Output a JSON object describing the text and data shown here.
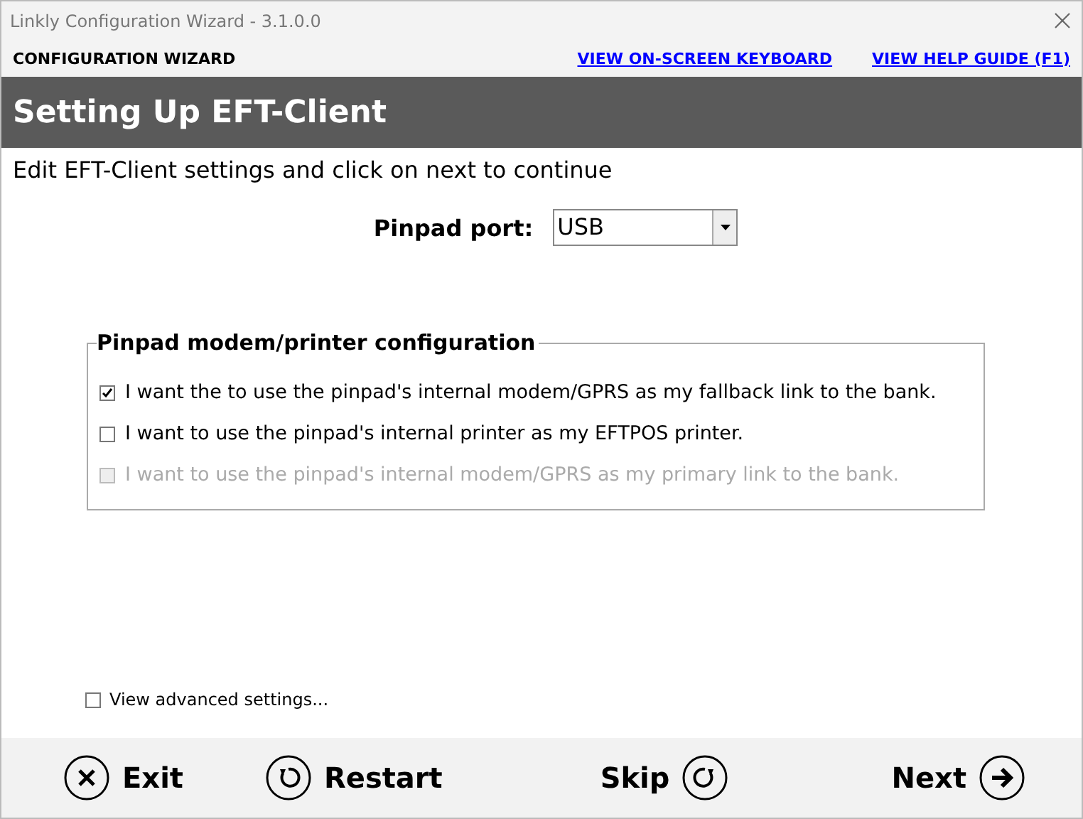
{
  "window": {
    "title": "Linkly Configuration Wizard - 3.1.0.0"
  },
  "header": {
    "label": "CONFIGURATION WIZARD",
    "links": [
      "VIEW ON-SCREEN KEYBOARD",
      "VIEW HELP GUIDE (F1)"
    ]
  },
  "banner": {
    "title": "Setting Up EFT-Client"
  },
  "instruction": "Edit EFT-Client settings and click on next to continue",
  "pinpad_port": {
    "label": "Pinpad port:",
    "value": "USB"
  },
  "group": {
    "title": "Pinpad modem/printer configuration",
    "options": [
      {
        "label": "I want the to use the pinpad's internal modem/GPRS as my fallback link to the bank.",
        "checked": true,
        "disabled": false
      },
      {
        "label": "I want to use the pinpad's internal printer as my EFTPOS printer.",
        "checked": false,
        "disabled": false
      },
      {
        "label": "I want to use the pinpad's internal modem/GPRS as my primary link to the bank.",
        "checked": false,
        "disabled": true
      }
    ]
  },
  "advanced": {
    "label": "View advanced settings...",
    "checked": false
  },
  "buttons": [
    {
      "label": "Exit",
      "kind": "exit"
    },
    {
      "label": "Restart",
      "kind": "restart"
    },
    {
      "label": "Skip",
      "kind": "skip"
    },
    {
      "label": "Next",
      "kind": "next"
    }
  ]
}
